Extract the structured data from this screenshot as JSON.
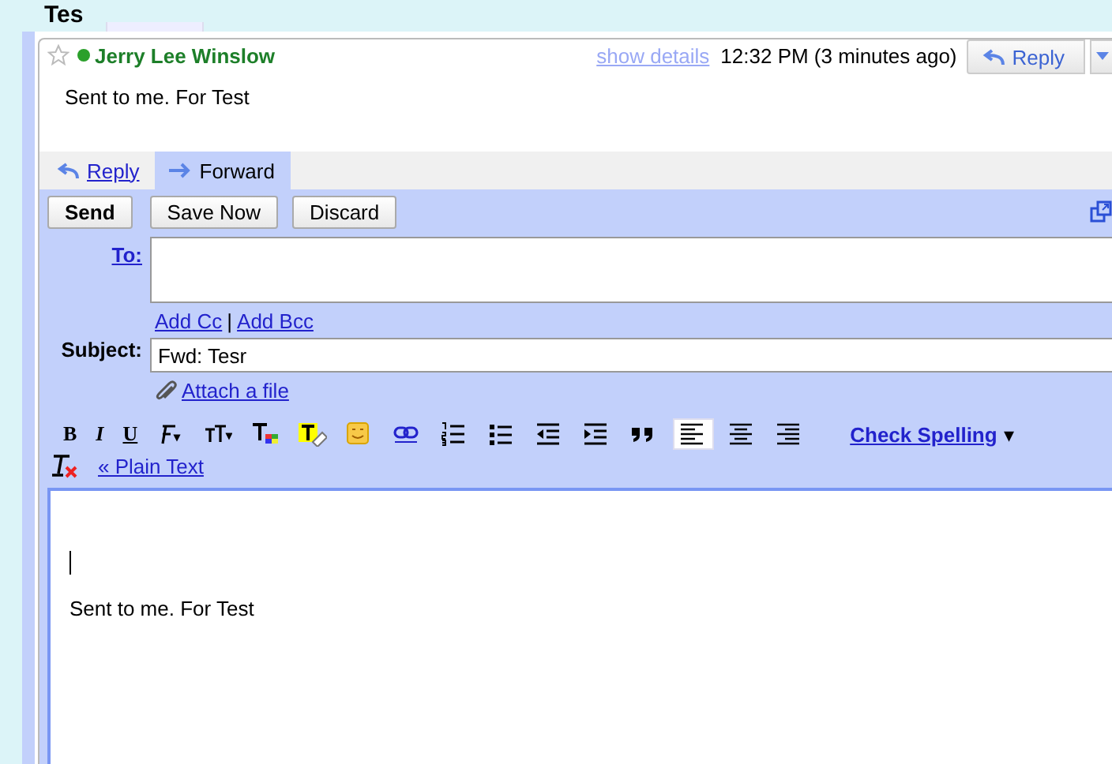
{
  "page_title": "Tes",
  "message": {
    "starred": false,
    "sender": "Jerry Lee Winslow",
    "online": true,
    "show_details": "show details",
    "time": "12:32 PM (3 minutes ago)",
    "reply_button": "Reply",
    "body": "Sent to me. For Test"
  },
  "tabs": [
    {
      "label": "Reply",
      "selected": false
    },
    {
      "label": "Forward",
      "selected": true
    }
  ],
  "buttons": [
    {
      "label": "Send",
      "bold": true
    },
    {
      "label": "Save Now",
      "bold": false
    },
    {
      "label": "Discard",
      "bold": false
    }
  ],
  "to": {
    "label": "To:"
  },
  "add_cc": "Add Cc",
  "separator": "|",
  "add_bcc": "Add Bcc",
  "subject": {
    "label": "Subject:",
    "value": "Fwd: Tesr"
  },
  "attach": "Attach a file",
  "toolbar": [
    {
      "kind": "bold",
      "label": "B",
      "selected": false
    },
    {
      "kind": "italic",
      "label": "I",
      "selected": false
    },
    {
      "kind": "underline",
      "label": "U",
      "selected": false
    },
    {
      "kind": "font",
      "selected": false
    },
    {
      "kind": "size",
      "selected": false
    },
    {
      "kind": "color",
      "selected": false
    },
    {
      "kind": "highlight",
      "selected": false
    },
    {
      "kind": "emoji",
      "selected": false
    },
    {
      "kind": "link",
      "selected": false
    },
    {
      "kind": "numbered",
      "selected": false
    },
    {
      "kind": "bullets",
      "selected": false
    },
    {
      "kind": "outdent",
      "selected": false
    },
    {
      "kind": "indent",
      "selected": false
    },
    {
      "kind": "quote",
      "selected": false
    },
    {
      "kind": "align-left",
      "selected": true
    },
    {
      "kind": "align-center",
      "selected": false
    },
    {
      "kind": "align-right",
      "selected": false
    }
  ],
  "check_spelling": "Check Spelling",
  "check_caret": "▾",
  "plain_text": "« Plain Text",
  "editor": {
    "body": "Sent to me. For Test"
  }
}
